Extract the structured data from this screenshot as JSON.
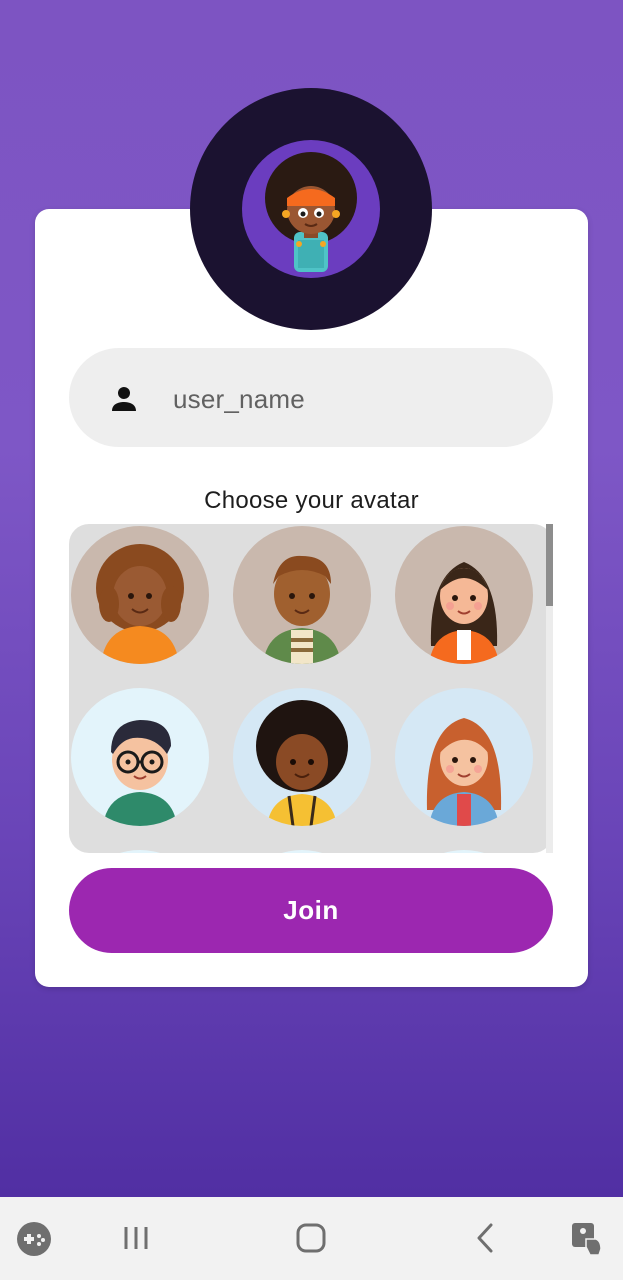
{
  "colors": {
    "background_top": "#7d54c2",
    "background_bottom": "#4b2a9e",
    "card": "#ffffff",
    "hero_ring": "#1b1230",
    "hero_inner": "#6b3dbf",
    "input_bg": "#eeeeee",
    "grid_bg": "#dedede",
    "join_button": "#9c27b0"
  },
  "profile": {
    "selected_avatar": "girl-afro-orange-headband-avatar"
  },
  "username": {
    "icon": "person-icon",
    "value": "user_name"
  },
  "avatar_picker": {
    "label": "Choose your avatar",
    "avatars": [
      {
        "name": "girl-curly-brown-hair-avatar"
      },
      {
        "name": "boy-brown-hair-green-jacket-avatar"
      },
      {
        "name": "girl-long-dark-hair-orange-jacket-avatar"
      },
      {
        "name": "boy-glasses-green-shirt-avatar"
      },
      {
        "name": "boy-curly-black-hair-yellow-shirt-avatar"
      },
      {
        "name": "girl-red-hair-denim-jacket-avatar"
      }
    ]
  },
  "join_button": {
    "label": "Join"
  },
  "nav_bar": {
    "items": [
      "game-launcher-icon",
      "recent-apps-icon",
      "home-icon",
      "back-icon",
      "assistant-touch-icon"
    ]
  }
}
